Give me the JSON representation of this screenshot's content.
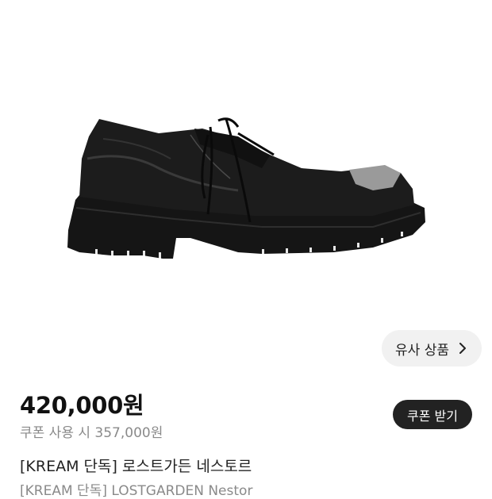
{
  "product": {
    "image_alt": "black leather derby shoe with lug sole and silver toe cap",
    "similar_label": "유사 상품",
    "price": "420,000원",
    "coupon_price": "쿠폰 사용 시 357,000원",
    "coupon_button": "쿠폰 받기",
    "title": "[KREAM 단독] 로스트가든 네스토르",
    "subtitle": "[KREAM 단독] LOSTGARDEN Nestor"
  },
  "colors": {
    "background": "#ffffff",
    "text_primary": "#222222",
    "text_secondary": "#8a8a8a",
    "pill_bg": "#f1f1f1",
    "dark_button": "#222222"
  }
}
